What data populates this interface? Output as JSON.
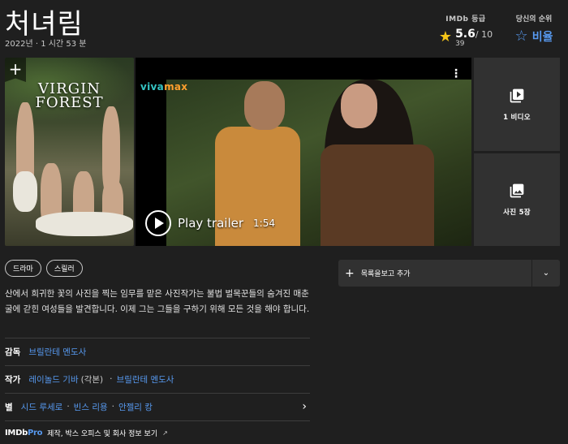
{
  "header": {
    "title": "처녀림",
    "year": "2022년",
    "separator": "·",
    "runtime": "1 시간 53 분"
  },
  "rating": {
    "label": "IMDb 등급",
    "value": "5.6",
    "max": "/ 10",
    "count": "39",
    "star_color": "#f5c518"
  },
  "your_rating": {
    "label": "당신의 순위",
    "action": "비율",
    "color": "#5799ef"
  },
  "poster": {
    "title_line1": "VIRGIN",
    "title_line2": "FOREST",
    "add_icon": "plus-icon"
  },
  "video": {
    "brand_viva": "viva",
    "brand_max": "max",
    "play_label": "Play trailer",
    "duration": "1:54",
    "menu_icon": "kebab-menu-icon"
  },
  "tiles": {
    "videos_label": "1 비디오",
    "photos_label": "사진 5장",
    "videos_icon": "video-library-icon",
    "photos_icon": "photo-library-icon"
  },
  "genres": [
    "드라마",
    "스릴러"
  ],
  "plot": "산에서 희귀한 꽃의 사진을 찍는 임무를 맡은 사진작가는 불법 벌목꾼들의 숨겨진 매춘굴에 갇힌 여성들을 발견합니다. 이제 그는 그들을 구하기 위해 모든 것을 해야 합니다.",
  "credits": {
    "director_label": "감독",
    "director": "브릴란테 멘도사",
    "writer_label": "작가",
    "writer_1": "레이놀드 기바",
    "writer_1_note": "(각본)",
    "writer_2": "브릴란테 멘도사",
    "stars_label": "별",
    "star_1": "시드 루세로",
    "star_2": "빈스 리용",
    "star_3": "안젤리 캉",
    "dot": "·"
  },
  "imdbpro": {
    "logo_imdb": "IMDb",
    "logo_pro": "Pro",
    "link_text": "제작, 박스 오피스 및 회사 정보 보기"
  },
  "watchlist": {
    "label": "목록을보고 추가",
    "plus_icon": "plus-icon",
    "dropdown_icon": "chevron-down-icon"
  },
  "colors": {
    "background": "#1f1f1f",
    "tile": "#313131",
    "link": "#5799ef",
    "imdb_yellow": "#f5c518"
  }
}
